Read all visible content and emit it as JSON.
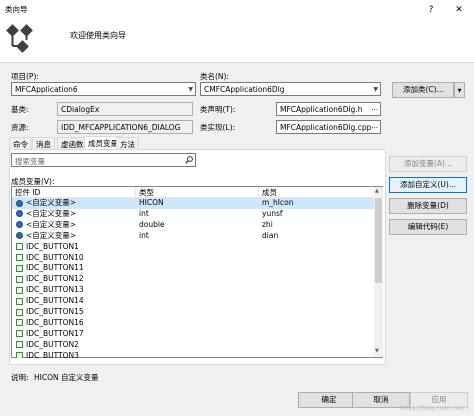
{
  "window": {
    "title": "类向导",
    "help_glyph": "?",
    "close_glyph": "✕",
    "header_text": "欢迎使用类向导"
  },
  "project": {
    "label": "项目(P):",
    "value": "MFCApplication6"
  },
  "class_name": {
    "label": "类名(N):",
    "value": "CMFCApplication6Dlg"
  },
  "add_class_button": "添加类(C)...",
  "base_class": {
    "label": "基类:",
    "value": "CDialogEx"
  },
  "resource": {
    "label": "资源:",
    "value": "IDD_MFCAPPLICATION6_DIALOG"
  },
  "header_file": {
    "label": "类声明(T):",
    "value": "MFCApplication6Dlg.h"
  },
  "impl_file": {
    "label": "类实现(L):",
    "value": "MFCApplication6Dlg.cpp"
  },
  "ellipsis": "...",
  "tabs": [
    "命令",
    "消息",
    "虚函数",
    "成员变量",
    "方法"
  ],
  "active_tab": 3,
  "search": {
    "placeholder": "搜索变量"
  },
  "members_label": "成员变量(V):",
  "columns": [
    "控件 ID",
    "类型",
    "成员"
  ],
  "rows": [
    {
      "id": "<自定义变量>",
      "type": "HICON",
      "member": "m_hIcon",
      "icon": "variable-icon",
      "selected": true
    },
    {
      "id": "<自定义变量>",
      "type": "int",
      "member": "yunsf",
      "icon": "variable-icon"
    },
    {
      "id": "<自定义变量>",
      "type": "double",
      "member": "zhi",
      "icon": "variable-icon"
    },
    {
      "id": "<自定义变量>",
      "type": "int",
      "member": "dian",
      "icon": "variable-icon"
    },
    {
      "id": "IDC_BUTTON1",
      "type": "",
      "member": "",
      "icon": "control-icon"
    },
    {
      "id": "IDC_BUTTON10",
      "type": "",
      "member": "",
      "icon": "control-icon"
    },
    {
      "id": "IDC_BUTTON11",
      "type": "",
      "member": "",
      "icon": "control-icon"
    },
    {
      "id": "IDC_BUTTON12",
      "type": "",
      "member": "",
      "icon": "control-icon"
    },
    {
      "id": "IDC_BUTTON13",
      "type": "",
      "member": "",
      "icon": "control-icon"
    },
    {
      "id": "IDC_BUTTON14",
      "type": "",
      "member": "",
      "icon": "control-icon"
    },
    {
      "id": "IDC_BUTTON15",
      "type": "",
      "member": "",
      "icon": "control-icon"
    },
    {
      "id": "IDC_BUTTON16",
      "type": "",
      "member": "",
      "icon": "control-icon"
    },
    {
      "id": "IDC_BUTTON17",
      "type": "",
      "member": "",
      "icon": "control-icon"
    },
    {
      "id": "IDC_BUTTON2",
      "type": "",
      "member": "",
      "icon": "control-icon"
    },
    {
      "id": "IDC_BUTTON3",
      "type": "",
      "member": "",
      "icon": "control-icon"
    }
  ],
  "side_buttons": {
    "add_variable": "添加变量(A)...",
    "add_custom": "添加自定义(U)...",
    "delete_variable": "删除变量(D)",
    "edit_code": "编辑代码(E)"
  },
  "description": {
    "label": "说明:",
    "value": "HICON 自定义变量"
  },
  "footer": {
    "ok": "确定",
    "cancel": "取消",
    "apply": "应用"
  },
  "watermark": "https://blog.csdn.net/..."
}
